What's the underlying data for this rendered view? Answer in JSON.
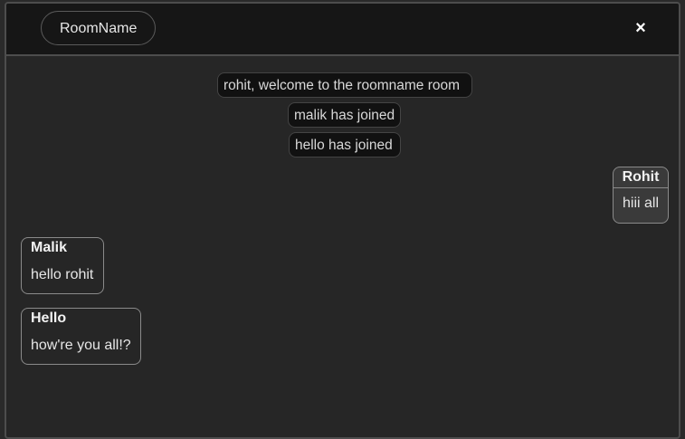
{
  "header": {
    "room_name": "RoomName",
    "close_label": "×"
  },
  "system_messages": [
    "rohit, welcome to the roomname room",
    "malik has joined",
    "hello has joined"
  ],
  "chat_messages": [
    {
      "author": "Rohit",
      "text": "hiii all",
      "own": true
    },
    {
      "author": "Malik",
      "text": "hello rohit",
      "own": false
    },
    {
      "author": "Hello",
      "text": "how're you all!?",
      "own": false
    }
  ]
}
